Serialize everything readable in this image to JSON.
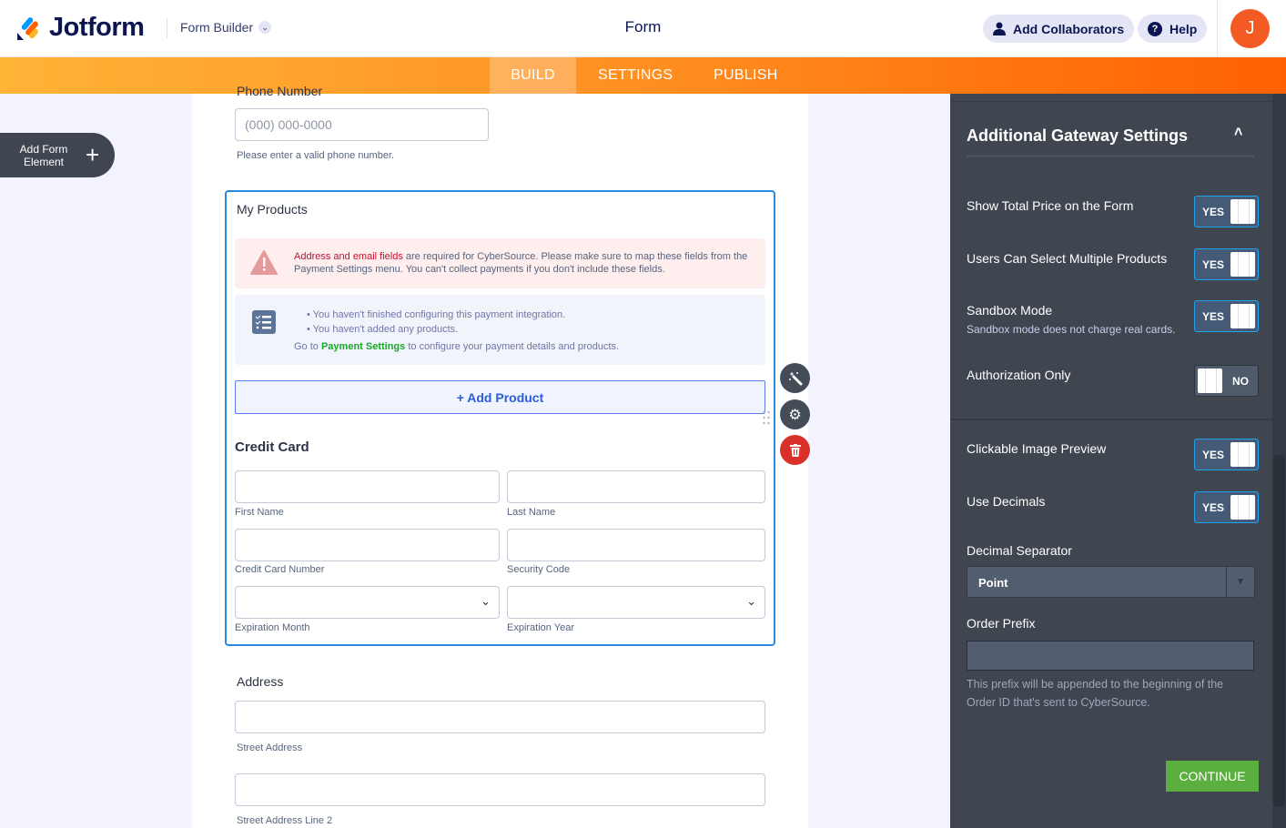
{
  "header": {
    "brand": "Jotform",
    "form_builder": "Form Builder",
    "title": "Form",
    "add_collaborators": "Add Collaborators",
    "help": "Help",
    "avatar_initial": "J"
  },
  "tabs": [
    {
      "label": "BUILD"
    },
    {
      "label": "SETTINGS"
    },
    {
      "label": "PUBLISH"
    }
  ],
  "sidebar": {
    "add_element": "Add Form Element"
  },
  "form": {
    "phone_label": "Phone Number",
    "phone_placeholder": "(000) 000-0000",
    "phone_hint": "Please enter a valid phone number.",
    "products_title": "My Products",
    "warning_bold": "Address and email fields",
    "warning_text": " are required for CyberSource. Please make sure to map these fields from the Payment Settings menu. You can't collect payments if you don't include these fields.",
    "info_items": [
      "You haven't finished configuring this payment integration.",
      "You haven't added any products."
    ],
    "info_prefix": "Go to ",
    "info_link": "Payment Settings",
    "info_suffix": " to configure your payment details and products.",
    "add_product": "+ Add Product",
    "credit_card": "Credit Card",
    "first_name": "First Name",
    "last_name": "Last Name",
    "cc_number": "Credit Card Number",
    "security_code": "Security Code",
    "exp_month": "Expiration Month",
    "exp_year": "Expiration Year",
    "address": "Address",
    "street": "Street Address",
    "street2": "Street Address Line 2"
  },
  "panel": {
    "title": "Additional Gateway Settings",
    "settings": [
      {
        "label": "Show Total Price on the Form",
        "value": "YES"
      },
      {
        "label": "Users Can Select Multiple Products",
        "value": "YES"
      },
      {
        "label": "Sandbox Mode",
        "sub": "Sandbox mode does not charge real cards.",
        "value": "YES"
      },
      {
        "label": "Authorization Only",
        "value": "NO"
      },
      {
        "label": "Clickable Image Preview",
        "value": "YES"
      },
      {
        "label": "Use Decimals",
        "value": "YES"
      }
    ],
    "decimal_label": "Decimal Separator",
    "decimal_value": "Point",
    "prefix_label": "Order Prefix",
    "prefix_value": "",
    "prefix_hint": "This prefix will be appended to the beginning of the Order ID that's sent to CyberSource.",
    "continue": "CONTINUE"
  },
  "colors": {
    "accent": "#ff6100",
    "toggle_on": "#455a77",
    "continue": "#5aaf3f",
    "error": "#c8102e",
    "link": "#18a82b"
  }
}
